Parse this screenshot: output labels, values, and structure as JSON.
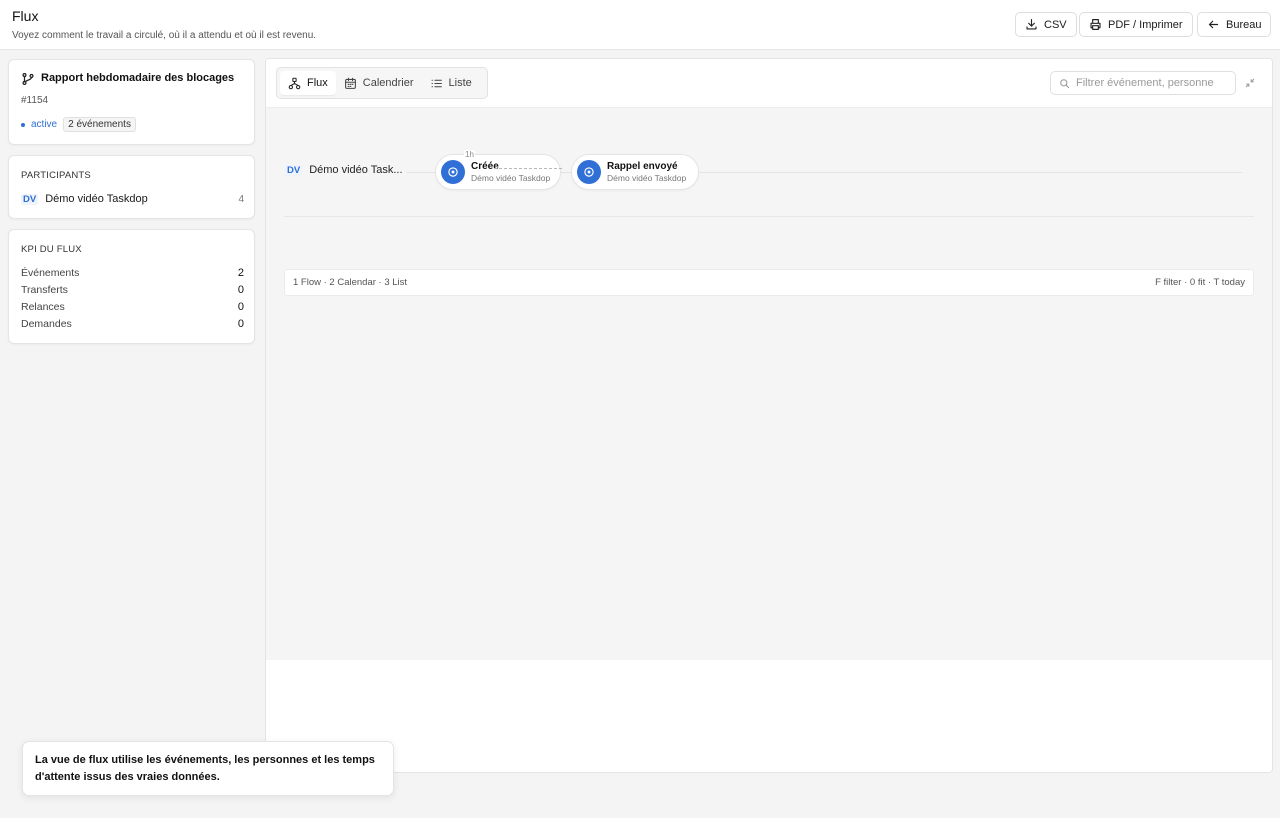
{
  "header": {
    "title": "Flux",
    "subtitle": "Voyez comment le travail a circulé, où il a attendu et où il est revenu.",
    "buttons": {
      "csv": "CSV",
      "pdf": "PDF / Imprimer",
      "back": "Bureau"
    }
  },
  "ticket": {
    "title": "Rapport hebdomadaire des blocages",
    "id": "#1154",
    "status": "active",
    "events_badge": "2 événements"
  },
  "participants": {
    "label": "PARTICIPANTS",
    "items": [
      {
        "initials": "DV",
        "name": "Démo vidéo Taskdop",
        "count": "4"
      }
    ]
  },
  "kpi": {
    "label": "KPI DU FLUX",
    "items": [
      {
        "label": "Événements",
        "value": "2"
      },
      {
        "label": "Transferts",
        "value": "0"
      },
      {
        "label": "Relances",
        "value": "0"
      },
      {
        "label": "Demandes",
        "value": "0"
      }
    ]
  },
  "tabs": [
    {
      "label": "Flux",
      "active": true
    },
    {
      "label": "Calendrier",
      "active": false
    },
    {
      "label": "Liste",
      "active": false
    }
  ],
  "filter": {
    "placeholder": "Filtrer événement, personne"
  },
  "flow": {
    "lane": {
      "initials": "DV",
      "name": "Démo vidéo Task..."
    },
    "duration": "1h",
    "nodes": [
      {
        "title": "Créée",
        "subtitle": "Démo vidéo Taskdop"
      },
      {
        "title": "Rappel envoyé",
        "subtitle": "Démo vidéo Taskdop"
      }
    ]
  },
  "shortcuts": {
    "left": "1 Flow · 2 Calendar · 3 List",
    "right": "F filter · 0 fit · T today"
  },
  "toast": {
    "message": "La vue de flux utilise les événements, les personnes et les temps d'attente issus des vraies données."
  },
  "colors": {
    "accent": "#2f6fd6",
    "background": "#f4f4f4",
    "surface": "#ffffff"
  }
}
